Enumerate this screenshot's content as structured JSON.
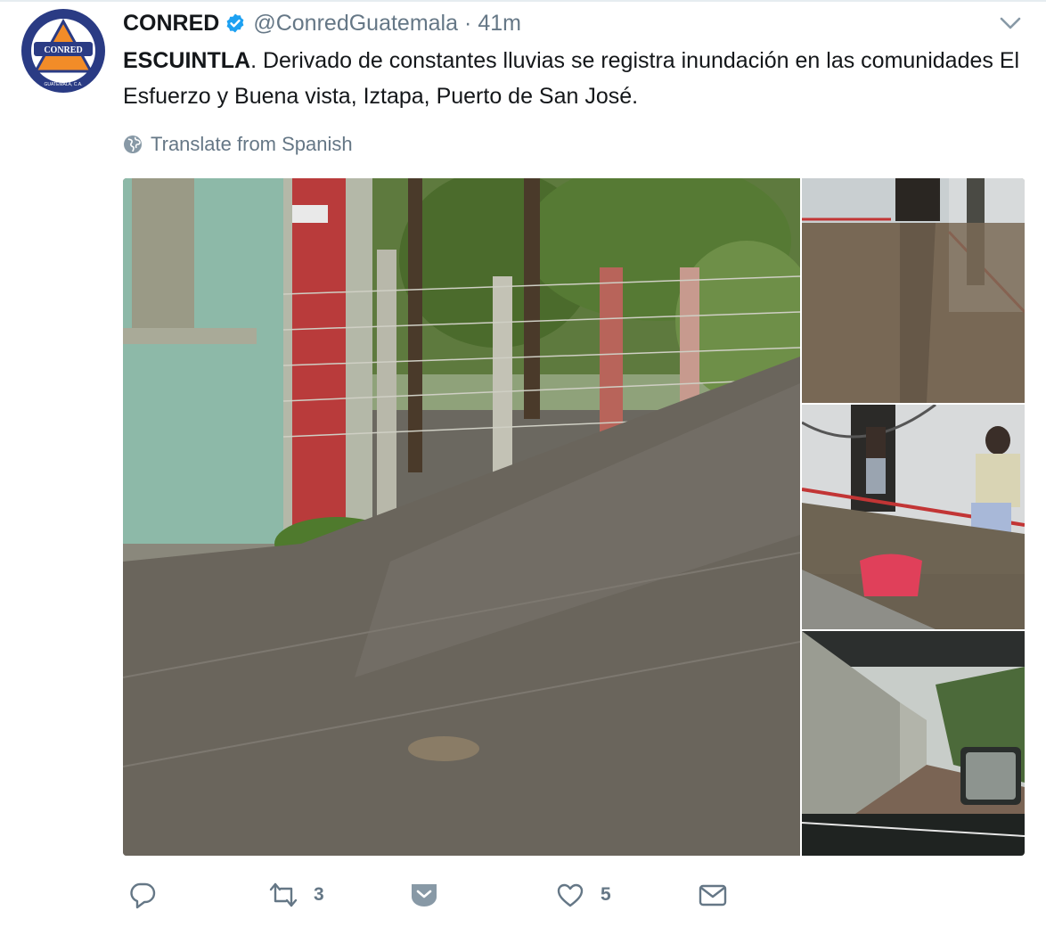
{
  "tweet": {
    "display_name": "CONRED",
    "handle": "@ConredGuatemala",
    "separator": "·",
    "time": "41m",
    "verified": true,
    "text_bold": "ESCUINTLA",
    "text_rest": ". Derivado de constantes lluvias se registra inundación en las comunidades El Esfuerzo y Buena vista, Iztapa, Puerto de San José.",
    "translate_label": "Translate from Spanish",
    "avatar_text": "CONRED",
    "avatar_ring_text": "GUATEMALA, C.A."
  },
  "media": [
    {
      "icon": "photo-flooded-street"
    },
    {
      "icon": "photo-flooded-hallway"
    },
    {
      "icon": "photo-flooded-house-people"
    },
    {
      "icon": "photo-flooded-alley-from-car"
    }
  ],
  "actions": {
    "reply": {
      "icon": "reply-icon",
      "count": ""
    },
    "retweet": {
      "icon": "retweet-icon",
      "count": "3"
    },
    "direct_message": {
      "icon": "dm-icon",
      "count": ""
    },
    "like": {
      "icon": "heart-icon",
      "count": "5"
    },
    "mail": {
      "icon": "envelope-icon",
      "count": ""
    }
  },
  "colors": {
    "text": "#14171a",
    "secondary": "#657786",
    "verified": "#1da1f2",
    "avatar_navy": "#2a3b84",
    "avatar_orange": "#f28c28"
  }
}
